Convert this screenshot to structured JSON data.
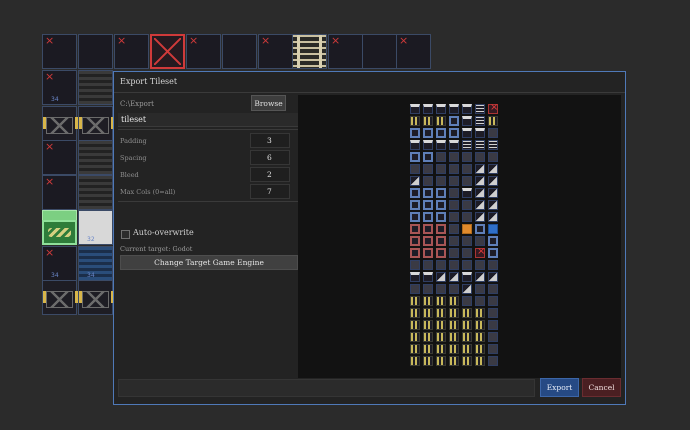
{
  "canvas": {
    "tile_numbers": [
      "34",
      "31",
      "32",
      "34",
      "34"
    ]
  },
  "dialog": {
    "title": "Export Tileset",
    "directory": "C:\\Export",
    "browse_label": "Browse",
    "filename": "tileset",
    "fields": [
      {
        "label": "Padding",
        "value": "3"
      },
      {
        "label": "Spacing",
        "value": "6"
      },
      {
        "label": "Bleed",
        "value": "2"
      },
      {
        "label": "Max Cols (0=all)",
        "value": "7"
      }
    ],
    "auto_overwrite_label": "Auto-overwrite",
    "auto_overwrite_checked": false,
    "current_target": "Current target: Godot",
    "change_engine_label": "Change Target Game Engine",
    "export_label": "Export",
    "cancel_label": "Cancel"
  },
  "colors": {
    "accent": "#4f79b8",
    "export_button": "#264a84",
    "cancel_button": "#4a1f22",
    "selection": "#7ccf82",
    "tile_marker": "#d03a3a"
  }
}
